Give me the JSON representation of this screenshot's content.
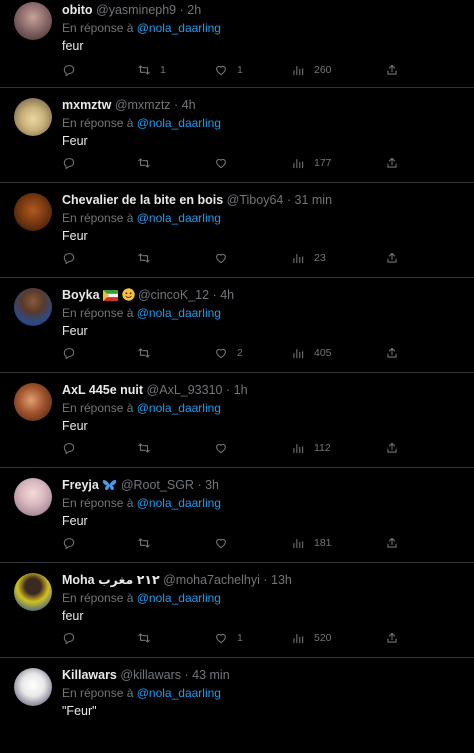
{
  "tweets": [
    {
      "name": "obito",
      "handle": "@yasmineph9",
      "time": "2h",
      "reply_prefix": "En réponse à",
      "reply_to": "@nola_daarling",
      "text": "feur",
      "replies": "",
      "retweets": "1",
      "likes": "1",
      "views": "260",
      "avatar_color": "#8a6a6a"
    },
    {
      "name": "mxmztw",
      "handle": "@mxmztz",
      "time": "4h",
      "reply_prefix": "En réponse à",
      "reply_to": "@nola_daarling",
      "text": "Feur",
      "replies": "",
      "retweets": "",
      "likes": "",
      "views": "177",
      "avatar_color": "#c9b27a"
    },
    {
      "name": "Chevalier de la bite en bois",
      "handle": "@Tiboy64",
      "time": "31 min",
      "reply_prefix": "En réponse à",
      "reply_to": "@nola_daarling",
      "text": "Feur",
      "replies": "",
      "retweets": "",
      "likes": "",
      "views": "23",
      "avatar_color": "#7a3a10"
    },
    {
      "name": "Boyka",
      "handle": "@cincoK_12",
      "time": "4h",
      "reply_prefix": "En réponse à",
      "reply_to": "@nola_daarling",
      "text": "Feur",
      "replies": "",
      "retweets": "",
      "likes": "2",
      "views": "405",
      "avatar_color": "#3a4a6a"
    },
    {
      "name": "AxL 445e nuit",
      "handle": "@AxL_93310",
      "time": "1h",
      "reply_prefix": "En réponse à",
      "reply_to": "@nola_daarling",
      "text": "Feur",
      "replies": "",
      "retweets": "",
      "likes": "",
      "views": "112",
      "avatar_color": "#a0522d"
    },
    {
      "name": "Freyja",
      "handle": "@Root_SGR",
      "time": "3h",
      "reply_prefix": "En réponse à",
      "reply_to": "@nola_daarling",
      "text": "Feur",
      "replies": "",
      "retweets": "",
      "likes": "",
      "views": "181",
      "avatar_color": "#d8b8c0"
    },
    {
      "name": "Moha ٢١٢ مغرب",
      "handle": "@moha7achelhyi",
      "time": "13h",
      "reply_prefix": "En réponse à",
      "reply_to": "@nola_daarling",
      "text": "feur",
      "replies": "",
      "retweets": "",
      "likes": "1",
      "views": "520",
      "avatar_color": "#d4c020"
    },
    {
      "name": "Killawars",
      "handle": "@killawars",
      "time": "43 min",
      "reply_prefix": "En réponse à",
      "reply_to": "@nola_daarling",
      "text": "\"Feur\"",
      "replies": "",
      "retweets": "",
      "likes": "",
      "views": "",
      "avatar_color": "#e8e8e8"
    }
  ],
  "dot": "·",
  "colors": {
    "background": "#000000",
    "text": "#e7e9ea",
    "muted": "#71767b",
    "link": "#1d9bf0",
    "border": "#2f3336"
  },
  "badges": {
    "boyka": [
      "flag-icon",
      "smiling-face-icon"
    ],
    "freyja": [
      "butterfly-icon"
    ]
  }
}
